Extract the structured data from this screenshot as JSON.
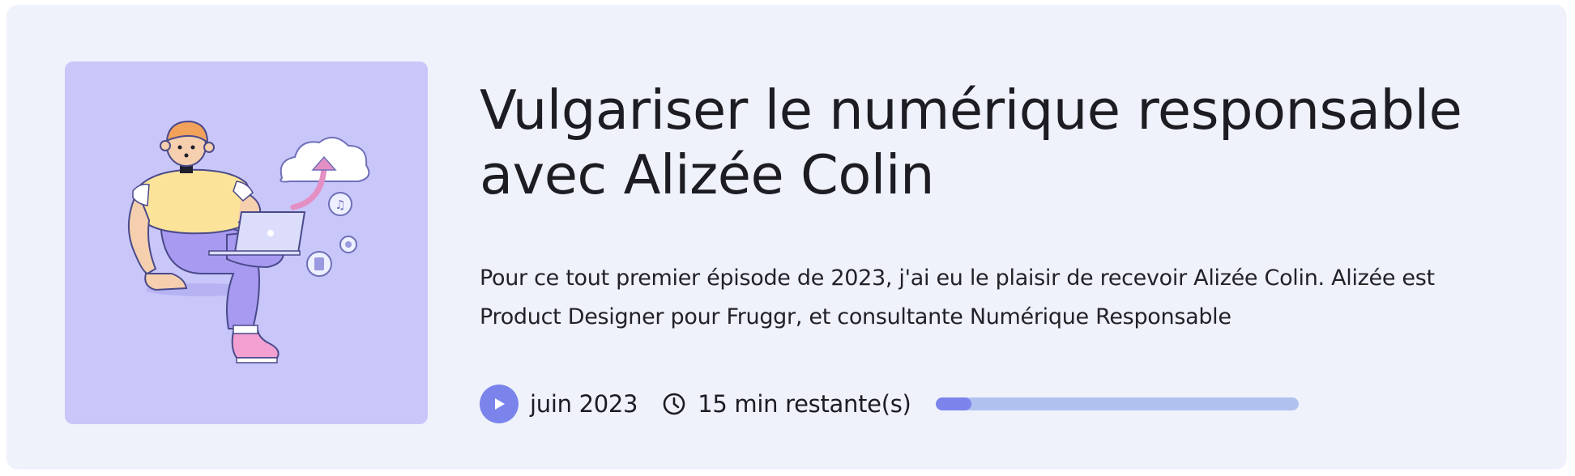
{
  "episode": {
    "title": "Vulgariser le numérique responsable avec Alizée Colin",
    "description": "Pour ce tout premier épisode de 2023, j'ai eu le plaisir de recevoir Alizée Colin. Alizée est Product Designer pour Fruggr, et consultante Numérique Responsable",
    "date": "juin 2023",
    "remaining": "15 min restante(s)",
    "progress_fraction": 0.1
  },
  "icons": {
    "play": "play-icon",
    "clock": "clock-icon",
    "cover": "illustration-person-laptop-cloud"
  },
  "colors": {
    "card_background": "#eff2fb",
    "cover_background": "#c9c6fa",
    "accent": "#7b84eb",
    "progress_track": "#b1c1ef",
    "text": "#1c1c22"
  }
}
